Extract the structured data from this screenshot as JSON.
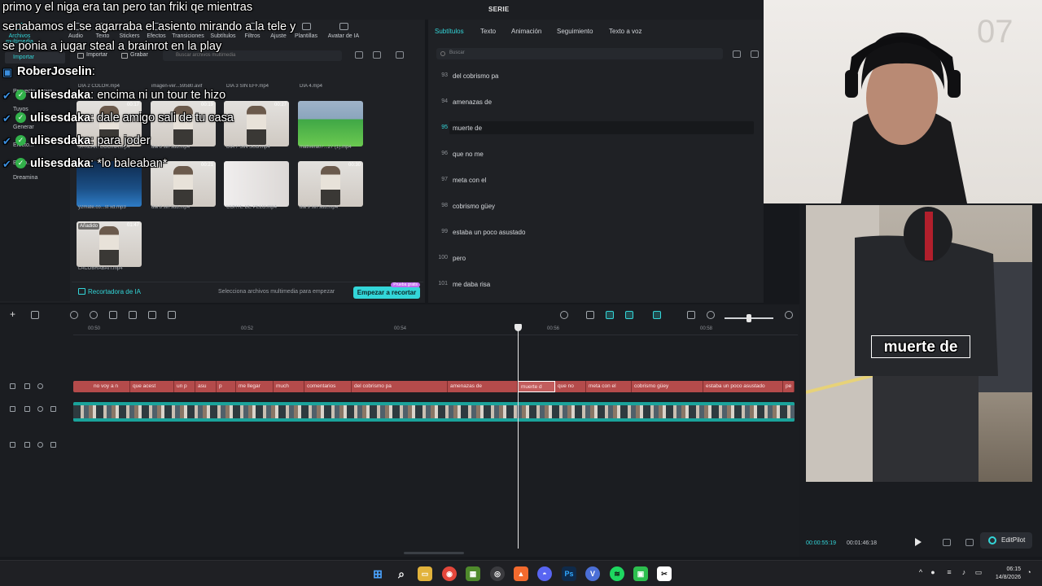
{
  "app": {
    "title": "SERIE"
  },
  "tool_tabs": [
    {
      "label": "Archivos multimedia",
      "active": true
    },
    {
      "label": "Audio"
    },
    {
      "label": "Texto"
    },
    {
      "label": "Stickers"
    },
    {
      "label": "Efectos"
    },
    {
      "label": "Transiciones"
    },
    {
      "label": "Subtítulos"
    },
    {
      "label": "Filtros"
    },
    {
      "label": "Ajuste"
    },
    {
      "label": "Plantillas"
    },
    {
      "label": "Avatar de IA"
    }
  ],
  "side_nav": [
    {
      "label": "Importar",
      "active": true
    },
    {
      "label": "Proyecto secun..."
    },
    {
      "label": "Tuyos"
    },
    {
      "label": "Generar"
    },
    {
      "label": "Efecto..."
    },
    {
      "label": "Biblio..."
    },
    {
      "label": "Dreamina"
    }
  ],
  "media_toolbar": {
    "import_label": "Importar",
    "record_label": "Grabar",
    "search_placeholder": "Buscar archivos multimedia"
  },
  "media_items": [
    {
      "name": "DIA 2 COLOR.mp4",
      "duration": ""
    },
    {
      "name": "imagen-ver...59580.avif",
      "duration": ""
    },
    {
      "name": "DIA 3 SIN EFF.mp4",
      "duration": ""
    },
    {
      "name": "DIA 4.mp4",
      "duration": ""
    },
    {
      "name": "STREAM COCINA.mp4",
      "duration": "00:17"
    },
    {
      "name": "dia 8 sin sub.mp4",
      "duration": "00:19"
    },
    {
      "name": "DIA 7 SIN SUB.mp4",
      "duration": "00:27"
    },
    {
      "name": "mativera07...27 (1).mp4",
      "duration": ""
    },
    {
      "name": "y2mate.co...st xd.mp3",
      "duration": ""
    },
    {
      "name": "dia 8 sin sub.mp4",
      "duration": "00:21"
    },
    {
      "name": "CORTE DE PELO.mp4",
      "duration": ""
    },
    {
      "name": "dia 9 sin sub.mp4",
      "duration": "00:30"
    },
    {
      "name": "LACOBRABAIT.mp4",
      "duration": "01:47",
      "tag": "Añadido"
    }
  ],
  "ai_bar": {
    "label": "Recortadora de IA",
    "hint": "Selecciona archivos multimedia para empezar",
    "button": "Empezar a recortar",
    "badge": "Prueba gratis"
  },
  "subtitle_panel": {
    "tabs": [
      {
        "label": "Subtítulos",
        "active": true
      },
      {
        "label": "Texto"
      },
      {
        "label": "Animación"
      },
      {
        "label": "Seguimiento"
      },
      {
        "label": "Texto a voz"
      }
    ],
    "search_placeholder": "Buscar",
    "rows": [
      {
        "num": "93",
        "text": "del cobrismo pa"
      },
      {
        "num": "94",
        "text": "amenazas de"
      },
      {
        "num": "95",
        "text": "muerte de",
        "active": true
      },
      {
        "num": "96",
        "text": "que no me"
      },
      {
        "num": "97",
        "text": "meta con el"
      },
      {
        "num": "98",
        "text": "cobrismo güey"
      },
      {
        "num": "99",
        "text": "estaba un poco asustado"
      },
      {
        "num": "100",
        "text": "pero"
      },
      {
        "num": "101",
        "text": "me daba risa"
      }
    ]
  },
  "timeline": {
    "ruler_ticks": [
      "00:50",
      "00:52",
      "00:54",
      "00:56",
      "00:58"
    ],
    "subtitle_clips": [
      {
        "text": "no voy a n"
      },
      {
        "text": "que acest"
      },
      {
        "text": "un p"
      },
      {
        "text": "asu"
      },
      {
        "text": "p"
      },
      {
        "text": "me llegar"
      },
      {
        "text": "much"
      },
      {
        "text": "comentarios"
      },
      {
        "text": "del cobrismo pa"
      },
      {
        "text": "amenazas de"
      },
      {
        "text": "muerte d",
        "selected": true
      },
      {
        "text": "que no"
      },
      {
        "text": "meta con el"
      },
      {
        "text": "cobrismo güey"
      },
      {
        "text": "estaba un poco asustado"
      },
      {
        "text": "pe"
      }
    ]
  },
  "preview": {
    "caption": "muerte de",
    "current_time": "00:00:55:19",
    "total_time": "00:01:46:18",
    "editpilot_label": "EditPilot"
  },
  "chat": {
    "overlay_lines": [
      "primo y el niga era tan pero tan friki qe mientras",
      "senabamos el se agarraba el asiento mirando a la tele y",
      "se ponia a jugar steal a brainrot en la play"
    ],
    "messages": [
      {
        "user": "RoberJoselin",
        "text": ":",
        "badges": "single"
      },
      {
        "user": "ulisesdaka",
        "text": ": encima ni un tour te hizo"
      },
      {
        "user": "ulisesdaka",
        "text": ": dale amigo sali de tu casa"
      },
      {
        "user": "ulisesdaka",
        "text": ": para joder"
      },
      {
        "user": "ulisesdaka",
        "text": ": *lo baleaban*"
      }
    ]
  },
  "taskbar": {
    "apps": [
      "windows-icon",
      "search-icon",
      "file-explorer-icon",
      "chrome-icon",
      "minecraft-icon",
      "obs-icon",
      "brave-icon",
      "discord-icon",
      "photoshop-icon",
      "vpn-icon",
      "spotify-icon",
      "game-icon",
      "capcut-icon"
    ],
    "app_glyphs": [
      "⊞",
      "⌕",
      "▭",
      "◉",
      "▦",
      "◎",
      "▲",
      "◓",
      "Ps",
      "V",
      "≋",
      "▣",
      "✂"
    ],
    "time": "06:15",
    "date": "14/8/2026"
  },
  "colors": {
    "accent": "#33d6d9",
    "subtitle_track": "#b44b4b",
    "video_track": "#1aa39b",
    "background": "#1f2125"
  }
}
